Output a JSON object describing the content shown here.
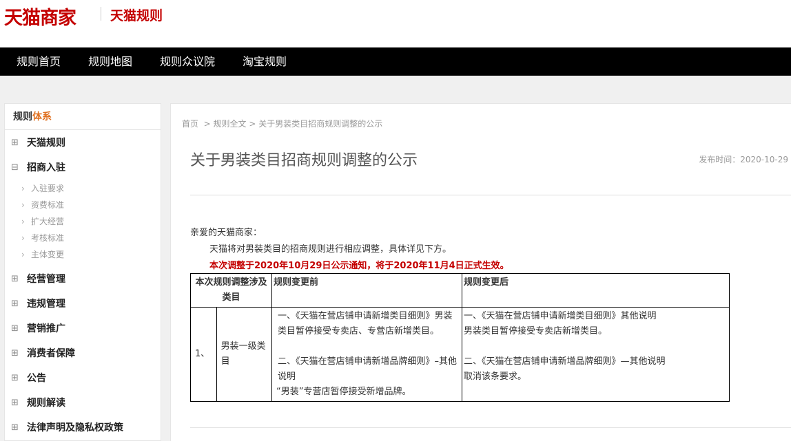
{
  "header": {
    "logo": "天猫商家",
    "sub_title": "天猫规则"
  },
  "nav": {
    "items": [
      "规则首页",
      "规则地图",
      "规则众议院",
      "淘宝规则"
    ]
  },
  "sidebar": {
    "title_prefix": "规则",
    "title_accent": "体系",
    "items": [
      {
        "icon": "⊞",
        "label": "天猫规则"
      },
      {
        "icon": "⊟",
        "label": "招商入驻"
      },
      {
        "icon": "⊞",
        "label": "经营管理"
      },
      {
        "icon": "⊞",
        "label": "违规管理"
      },
      {
        "icon": "⊞",
        "label": "营销推广"
      },
      {
        "icon": "⊞",
        "label": "消费者保障"
      },
      {
        "icon": "⊞",
        "label": "公告"
      },
      {
        "icon": "⊞",
        "label": "规则解读"
      },
      {
        "icon": "⊞",
        "label": "法律声明及隐私权政策"
      }
    ],
    "sub_items": [
      "入驻要求",
      "资费标准",
      "扩大经营",
      "考核标准",
      "主体变更"
    ]
  },
  "breadcrumb": {
    "items": [
      "首页",
      "规则全文",
      "关于男装类目招商规则调整的公示"
    ],
    "separator": ">"
  },
  "article": {
    "title": "关于男装类目招商规则调整的公示",
    "publish_label": "发布时间：",
    "publish_date": "2020-10-29",
    "greeting": "亲爱的天猫商家：",
    "intro": "天猫将对男装类目的招商规则进行相应调整，具体详见下方。",
    "notice": "本次调整于2020年10月29日公示通知，将于2020年11月4日正式生效。"
  },
  "table": {
    "headers": [
      "本次规则调整涉及类目",
      "规则变更前",
      "规则变更后"
    ],
    "row": {
      "index": "1、",
      "category": "男装一级类目",
      "before_1": "一、《天猫在营店铺申请新增类目细则》男装类目暂停接受专卖店、专营店新增类目。",
      "before_2": "二、《天猫在营店铺申请新增品牌细则》–其他说明",
      "before_3": "“男装”专营店暂停接受新增品牌。",
      "after_1": "一、《天猫在营店铺申请新增类目细则》其他说明",
      "after_1b": "男装类目暂停接受专卖店新增类目。",
      "after_2": "二、《天猫在营店铺申请新增品牌细则》—其他说明",
      "after_2b": "取消该条要求。"
    }
  },
  "colors": {
    "brand": "#c40000",
    "nav_bg": "#000000",
    "accent": "#e07020"
  }
}
